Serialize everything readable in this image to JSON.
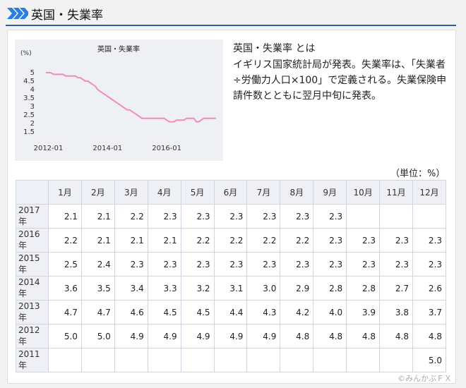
{
  "header": {
    "title": "英国・失業率"
  },
  "description": {
    "title": "英国・失業率 とは",
    "body": "イギリス国家統計局が発表。失業率は、「失業者÷労働力人口×100」で定義される。失業保険申請件数とともに翌月中旬に発表。"
  },
  "table": {
    "unit_label": "（単位：%）",
    "months": [
      "1月",
      "2月",
      "3月",
      "4月",
      "5月",
      "6月",
      "7月",
      "8月",
      "9月",
      "10月",
      "11月",
      "12月"
    ],
    "rows": [
      {
        "year": "2017年",
        "values": [
          "2.1",
          "2.1",
          "2.2",
          "2.3",
          "2.3",
          "2.3",
          "2.3",
          "2.3",
          "2.3",
          "",
          "",
          ""
        ]
      },
      {
        "year": "2016年",
        "values": [
          "2.2",
          "2.1",
          "2.1",
          "2.1",
          "2.2",
          "2.2",
          "2.2",
          "2.2",
          "2.3",
          "2.3",
          "2.3",
          "2.3"
        ]
      },
      {
        "year": "2015年",
        "values": [
          "2.5",
          "2.4",
          "2.3",
          "2.3",
          "2.3",
          "2.3",
          "2.3",
          "2.3",
          "2.3",
          "2.3",
          "2.3",
          "2.3"
        ]
      },
      {
        "year": "2014年",
        "values": [
          "3.6",
          "3.5",
          "3.4",
          "3.3",
          "3.2",
          "3.1",
          "3.0",
          "2.9",
          "2.8",
          "2.8",
          "2.7",
          "2.6"
        ]
      },
      {
        "year": "2013年",
        "values": [
          "4.7",
          "4.7",
          "4.6",
          "4.5",
          "4.5",
          "4.4",
          "4.3",
          "4.2",
          "4.0",
          "3.9",
          "3.8",
          "3.7"
        ]
      },
      {
        "year": "2012年",
        "values": [
          "5.0",
          "5.0",
          "4.9",
          "4.9",
          "4.9",
          "4.9",
          "4.9",
          "4.8",
          "4.8",
          "4.8",
          "4.8",
          "4.8"
        ]
      },
      {
        "year": "2011年",
        "values": [
          "",
          "",
          "",
          "",
          "",
          "",
          "",
          "",
          "",
          "",
          "",
          "5.0"
        ]
      }
    ]
  },
  "copyright": "©みんかぶＦＸ",
  "chart_data": {
    "type": "line",
    "title": "英国・失業率",
    "ylabel": "(%)",
    "yticks": [
      "5",
      "4.5",
      "4",
      "3.5",
      "3",
      "2.5",
      "2",
      "1.5"
    ],
    "ylim": [
      1.5,
      5
    ],
    "xticks": [
      "2012-01",
      "2014-01",
      "2016-01"
    ],
    "xlim": [
      "2011-12",
      "2017-09"
    ],
    "line_color": "#f08cc0",
    "x": [
      "2011-12",
      "2012-01",
      "2012-02",
      "2012-03",
      "2012-04",
      "2012-05",
      "2012-06",
      "2012-07",
      "2012-08",
      "2012-09",
      "2012-10",
      "2012-11",
      "2012-12",
      "2013-01",
      "2013-02",
      "2013-03",
      "2013-04",
      "2013-05",
      "2013-06",
      "2013-07",
      "2013-08",
      "2013-09",
      "2013-10",
      "2013-11",
      "2013-12",
      "2014-01",
      "2014-02",
      "2014-03",
      "2014-04",
      "2014-05",
      "2014-06",
      "2014-07",
      "2014-08",
      "2014-09",
      "2014-10",
      "2014-11",
      "2014-12",
      "2015-01",
      "2015-02",
      "2015-03",
      "2015-04",
      "2015-05",
      "2015-06",
      "2015-07",
      "2015-08",
      "2015-09",
      "2015-10",
      "2015-11",
      "2015-12",
      "2016-01",
      "2016-02",
      "2016-03",
      "2016-04",
      "2016-05",
      "2016-06",
      "2016-07",
      "2016-08",
      "2016-09",
      "2016-10",
      "2016-11",
      "2016-12",
      "2017-01",
      "2017-02",
      "2017-03",
      "2017-04",
      "2017-05",
      "2017-06",
      "2017-07",
      "2017-08",
      "2017-09"
    ],
    "values": [
      5.0,
      5.0,
      5.0,
      4.9,
      4.9,
      4.9,
      4.9,
      4.9,
      4.8,
      4.8,
      4.8,
      4.8,
      4.8,
      4.7,
      4.7,
      4.6,
      4.5,
      4.5,
      4.4,
      4.3,
      4.2,
      4.0,
      3.9,
      3.8,
      3.7,
      3.6,
      3.5,
      3.4,
      3.3,
      3.2,
      3.1,
      3.0,
      2.9,
      2.8,
      2.8,
      2.7,
      2.6,
      2.5,
      2.4,
      2.3,
      2.3,
      2.3,
      2.3,
      2.3,
      2.3,
      2.3,
      2.3,
      2.3,
      2.3,
      2.2,
      2.1,
      2.1,
      2.1,
      2.2,
      2.2,
      2.2,
      2.2,
      2.3,
      2.3,
      2.3,
      2.3,
      2.1,
      2.1,
      2.2,
      2.3,
      2.3,
      2.3,
      2.3,
      2.3,
      2.3
    ]
  }
}
